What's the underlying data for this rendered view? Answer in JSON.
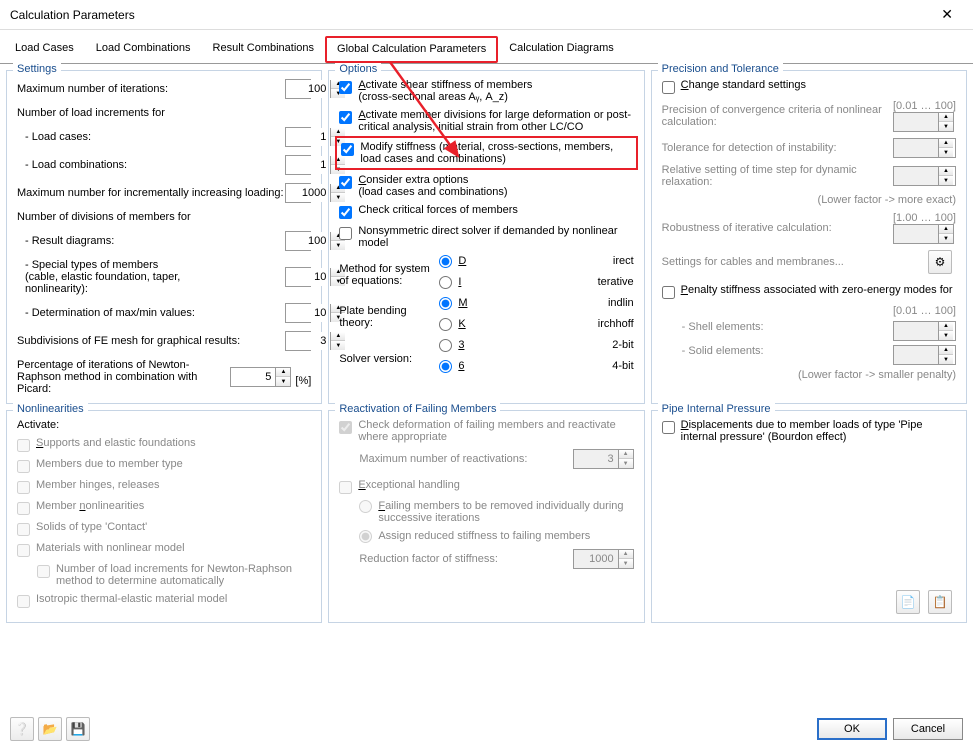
{
  "window": {
    "title": "Calculation Parameters"
  },
  "tabs": {
    "load_cases": "Load Cases",
    "load_combinations": "Load Combinations",
    "result_combinations": "Result Combinations",
    "global_params": "Global Calculation Parameters",
    "calc_diagrams": "Calculation Diagrams"
  },
  "settings": {
    "legend": "Settings",
    "max_iter_lbl": "Maximum number of iterations:",
    "max_iter": "100",
    "num_incr_lbl": "Number of load increments for",
    "load_cases_lbl": "- Load cases:",
    "load_cases": "1",
    "load_comb_lbl": "- Load combinations:",
    "load_comb": "1",
    "max_incr_loading_lbl": "Maximum number for incrementally increasing loading:",
    "max_incr_loading": "1000",
    "div_lbl": "Number of divisions of members for",
    "result_diag_lbl": "- Result diagrams:",
    "result_diag": "100",
    "special_lbl": "- Special types of members\n  (cable, elastic foundation, taper,\n  nonlinearity):",
    "special": "10",
    "maxmin_lbl": "- Determination of max/min values:",
    "maxmin": "10",
    "subdiv_lbl": "Subdivisions of FE mesh for graphical results:",
    "subdiv": "3",
    "pct_lbl": "Percentage of iterations of Newton-Raphson method in combination with Picard:",
    "pct": "5",
    "pct_unit": "[%]"
  },
  "options": {
    "legend": "Options",
    "shear_lbl": "Activate shear stiffness of members",
    "shear_sub": "(cross-sectional areas Aᵧ, A_z)",
    "div_deform_lbl": "Activate member divisions for large deformation or post-critical analysis, initial strain from other LC/CO",
    "modify_lbl": "Modify stiffness (material, cross-sections, members, load cases and combinations)",
    "extra_lbl": "Consider extra options",
    "extra_sub": "(load cases and combinations)",
    "check_crit_lbl": "Check critical forces of members",
    "nonsym_lbl": "Nonsymmetric direct solver if demanded by nonlinear model",
    "method_lbl": "Method for system of equations:",
    "direct": "Direct",
    "iterative": "Iterative",
    "plate_lbl": "Plate bending theory:",
    "mindlin": "Mindlin",
    "kirchhoff": "Kirchhoff",
    "solver_lbl": "Solver version:",
    "b32": "32-bit",
    "b64": "64-bit"
  },
  "precision": {
    "legend": "Precision and Tolerance",
    "change_lbl": "Change standard settings",
    "conv_lbl": "Precision of convergence criteria of nonlinear calculation:",
    "conv_range": "[0.01 … 100]",
    "tol_lbl": "Tolerance for detection of instability:",
    "time_lbl": "Relative setting of time step for dynamic relaxation:",
    "lower_exact": "(Lower factor -> more exact)",
    "robust_lbl": "Robustness of iterative calculation:",
    "robust_range": "[1.00 … 100]",
    "cable_settings": "Settings for cables and membranes...",
    "penalty_lbl": "Penalty stiffness associated with zero-energy modes for",
    "shell_lbl": "- Shell elements:",
    "solid_lbl": "- Solid elements:",
    "penalty_range": "[0.01 … 100]",
    "lower_smaller": "(Lower factor -> smaller penalty)"
  },
  "nonlin": {
    "legend": "Nonlinearities",
    "activate": "Activate:",
    "supports": "Supports and elastic foundations",
    "members_type": "Members due to member type",
    "hinges": "Member hinges, releases",
    "member_nonlin": "Member nonlinearities",
    "solids": "Solids of type 'Contact'",
    "materials": "Materials with nonlinear model",
    "nr_auto": "Number of load increments for Newton-Raphson method to determine automatically",
    "iso": "Isotropic thermal-elastic material model"
  },
  "react": {
    "legend": "Reactivation of Failing Members",
    "check_deform": "Check deformation of failing members and reactivate where appropriate",
    "max_react_lbl": "Maximum number of reactivations:",
    "max_react": "3",
    "except": "Exceptional handling",
    "remove": "Failing members to be removed individually during successive iterations",
    "assign": "Assign reduced stiffness to failing members",
    "reduction_lbl": "Reduction factor of stiffness:",
    "reduction": "1000"
  },
  "pipe": {
    "legend": "Pipe Internal Pressure",
    "disp_lbl": "Displacements due to member loads of type 'Pipe internal pressure' (Bourdon effect)"
  },
  "footer": {
    "ok": "OK",
    "cancel": "Cancel"
  }
}
